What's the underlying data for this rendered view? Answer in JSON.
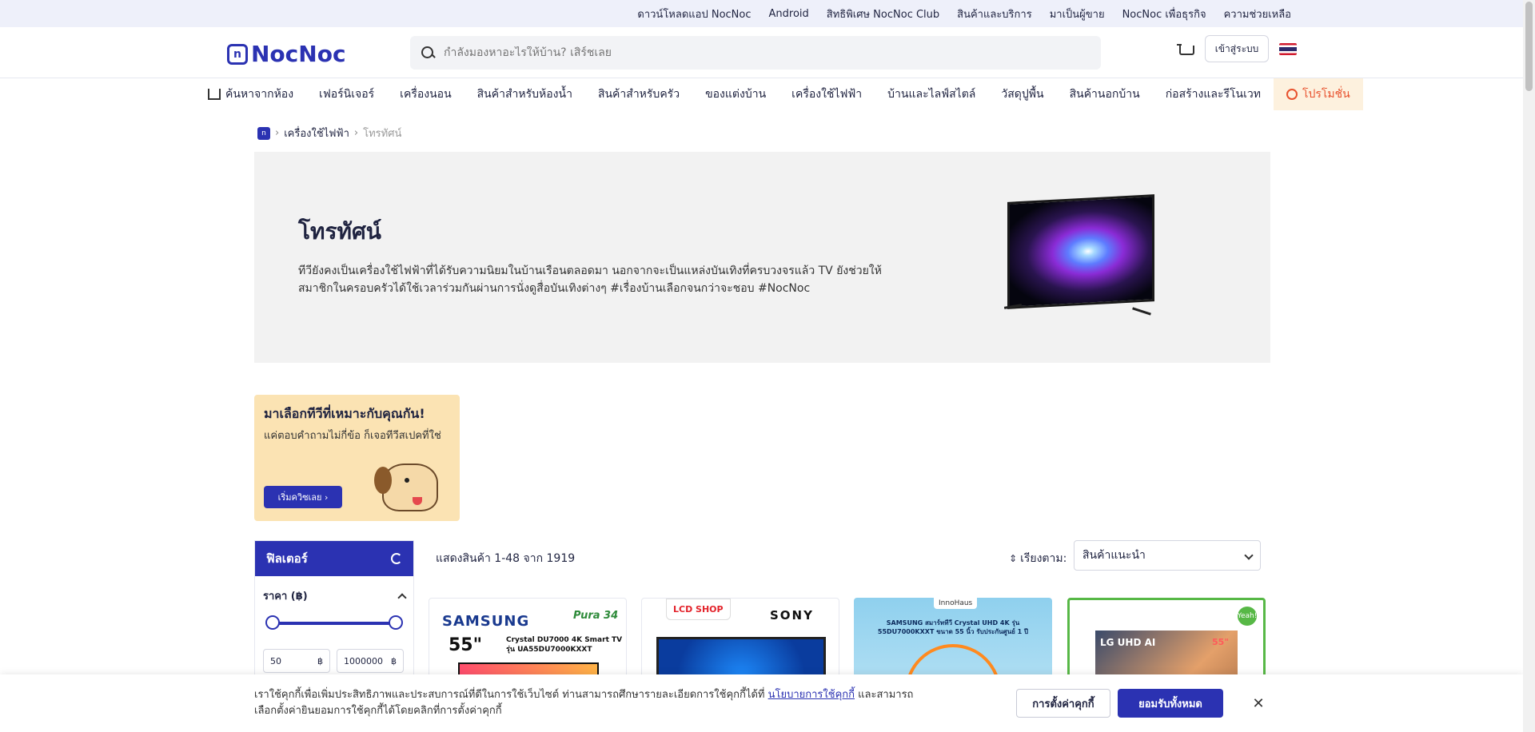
{
  "topbar": {
    "links": [
      "ดาวน์โหลดแอป NocNoc",
      "Android",
      "สิทธิพิเศษ NocNoc Club",
      "สินค้าและบริการ",
      "มาเป็นผู้ขาย",
      "NocNoc เพื่อธุรกิจ",
      "ความช่วยเหลือ"
    ]
  },
  "header": {
    "logo_text": "NocNoc",
    "logo_mark": "n",
    "search_placeholder": "กำลังมองหาอะไรให้บ้าน? เสิร์ชเลย",
    "login_label": "เข้าสู่ระบบ"
  },
  "nav": {
    "items": [
      "ค้นหาจากห้อง",
      "เฟอร์นิเจอร์",
      "เครื่องนอน",
      "สินค้าสำหรับห้องน้ำ",
      "สินค้าสำหรับครัว",
      "ของแต่งบ้าน",
      "เครื่องใช้ไฟฟ้า",
      "บ้านและไลฟ์สไตล์",
      "วัสดุปูพื้น",
      "สินค้านอกบ้าน",
      "ก่อสร้างและรีโนเวท",
      "โปรโมชั่น"
    ]
  },
  "breadcrumb": {
    "home_glyph": "n",
    "category": "เครื่องใช้ไฟฟ้า",
    "current": "โทรทัศน์",
    "separator": "›"
  },
  "hero": {
    "title": "โทรทัศน์",
    "description": "ทีวียังคงเป็นเครื่องใช้ไฟฟ้าที่ได้รับความนิยมในบ้านเรือนตลอดมา นอกจากจะเป็นแหล่งบันเทิงที่ครบวงจรแล้ว TV ยังช่วยให้สมาชิกในครอบครัวได้ใช้เวลาร่วมกันผ่านการนั่งดูสื่อบันเทิงต่างๆ #เรื่องบ้านเลือกจนกว่าจะชอบ #NocNoc"
  },
  "quiz": {
    "title": "มาเลือกทีวีที่เหมาะกับคุณกัน!",
    "subtitle": "แค่ตอบคำถามไม่กี่ข้อ ก็เจอทีวีสเปคที่ใช่",
    "button": "เริ่มควิซเลย ›"
  },
  "filter": {
    "title": "ฟิลเตอร์",
    "price_label": "ราคา (฿)",
    "min_value": "50",
    "max_value": "1000000",
    "currency": "฿"
  },
  "results": {
    "count_text": "แสดงสินค้า 1-48 จาก 1919",
    "sort_label": "เรียงตาม:",
    "sort_arrows": "⇕",
    "sort_value": "สินค้าแนะนำ"
  },
  "products": {
    "card1": {
      "brand": "SAMSUNG",
      "badge": "Pura 34",
      "size": "55\"",
      "model": "Crystal DU7000 4K Smart TV รุ่น UA55DU7000KXXT"
    },
    "card2": {
      "shop": "LCD SHOP",
      "brand": "SONY"
    },
    "card3": {
      "shop": "InnoHaus",
      "text": "SAMSUNG สมาร์ททีวี Crystal UHD 4K รุ่น 55DU7000KXXT ขนาด 55 นิ้ว รับประกันศูนย์ 1 ปี"
    },
    "card4": {
      "brand": "LG UHD AI",
      "size": "55\"",
      "badge": "Yeah!"
    }
  },
  "cookie": {
    "text_before": "เราใช้คุกกี้เพื่อเพิ่มประสิทธิภาพและประสบการณ์ที่ดีในการใช้เว็บไซต์ ท่านสามารถศึกษารายละเอียดการใช้คุกกี้ได้ที่ ",
    "link": "นโยบายการใช้คุกกี้",
    "text_after": " และสามารถเลือกตั้งค่ายินยอมการใช้คุกกี้ได้โดยคลิกที่การตั้งค่าคุกกี้",
    "settings_label": "การตั้งค่าคุกกี้",
    "accept_label": "ยอมรับทั้งหมด",
    "close_glyph": "✕"
  },
  "colors": {
    "brand": "#2b32b2",
    "promo": "#e8522e",
    "promo_bg": "#fdf1de",
    "quiz_bg": "#fbe3b3"
  },
  "icons": [
    "search-icon",
    "cart-icon",
    "thai-flag-icon",
    "home-room-icon",
    "promo-icon",
    "refresh-icon",
    "chevron-up-icon",
    "chevron-down-icon",
    "close-icon"
  ]
}
